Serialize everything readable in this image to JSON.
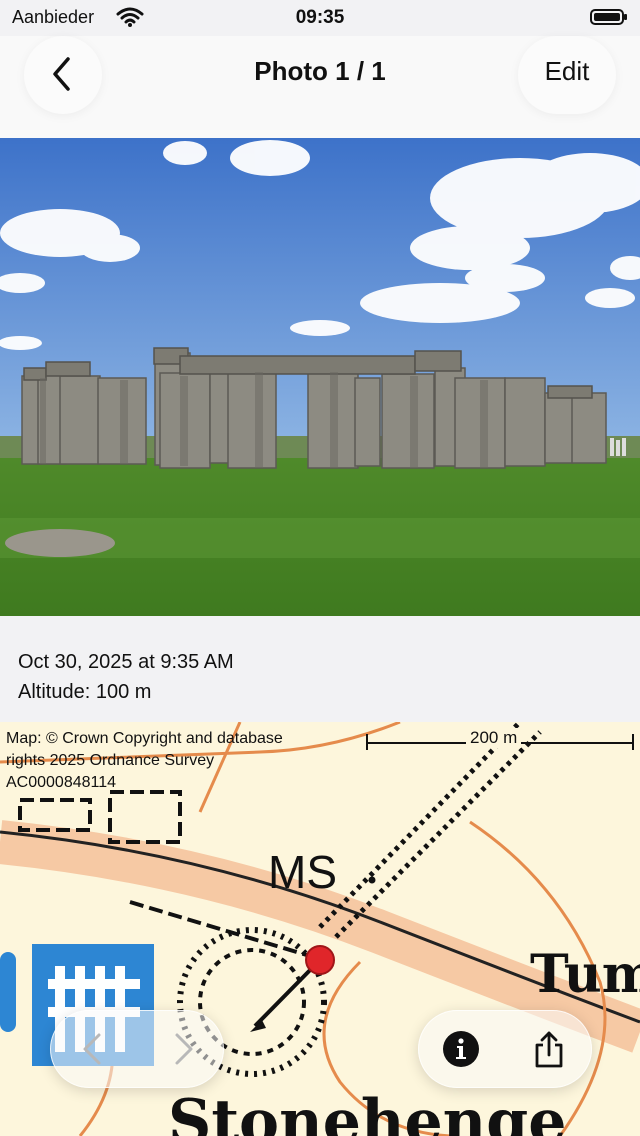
{
  "status_bar": {
    "carrier": "Aanbieder",
    "time": "09:35",
    "wifi_icon": "wifi-icon",
    "battery_icon": "battery-icon"
  },
  "nav": {
    "back_icon": "chevron-left-icon",
    "title": "Photo 1 / 1",
    "edit_label": "Edit"
  },
  "photo": {
    "subject": "Stonehenge stone circle under a blue sky with clouds"
  },
  "info": {
    "date": "Oct 30, 2025 at 9:35 AM",
    "altitude": "Altitude: 100 m"
  },
  "map": {
    "attribution": "Map: © Crown Copyright and database rights 2025 Ordnance Survey AC0000848114",
    "scale_label": "200 m",
    "label_ms": "MS",
    "label_tum": "Tum",
    "label_stonehenge": "Stonehenge",
    "pin_color": "#e0262a"
  },
  "controls": {
    "prev_icon": "chevron-left-icon",
    "next_icon": "chevron-right-icon",
    "info_icon": "info-icon",
    "share_icon": "share-icon"
  }
}
